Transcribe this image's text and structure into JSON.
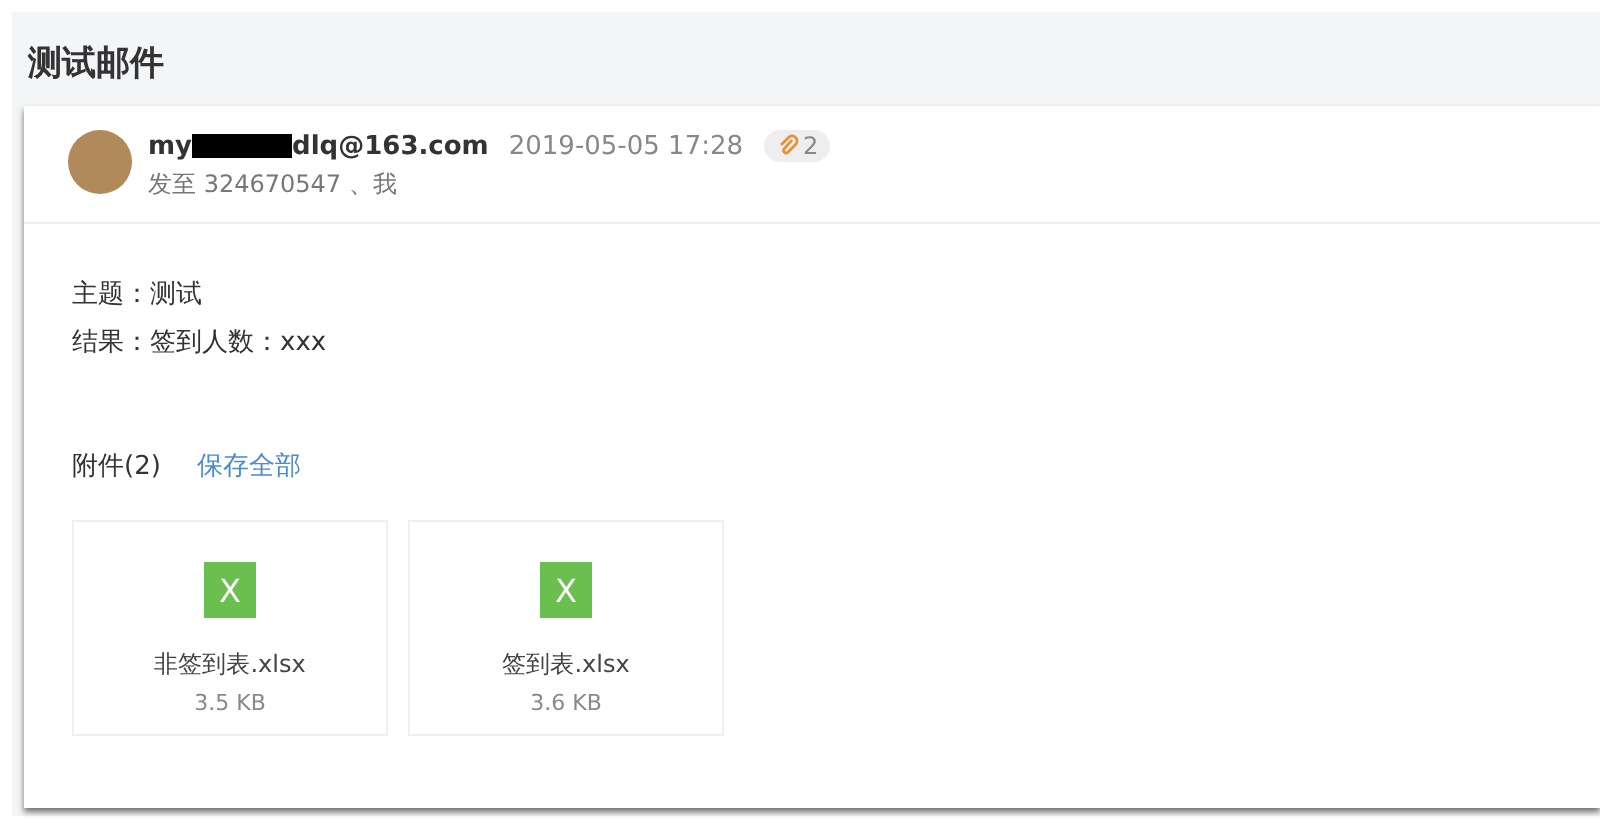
{
  "title": "测试邮件",
  "sender": {
    "before": "my",
    "after": "dlq@163.com",
    "redacted": true
  },
  "date": "2019-05-05 17:28",
  "attachment_count": "2",
  "recipients": "发至 324670547 、我",
  "body": [
    "主题：测试",
    "结果：签到人数：xxx"
  ],
  "attachments_label": "附件(2)",
  "save_all": "保存全部",
  "attachments": [
    {
      "icon_letter": "X",
      "name": "非签到表.xlsx",
      "size": "3.5 KB"
    },
    {
      "icon_letter": "X",
      "name": "签到表.xlsx",
      "size": "3.6 KB"
    }
  ]
}
